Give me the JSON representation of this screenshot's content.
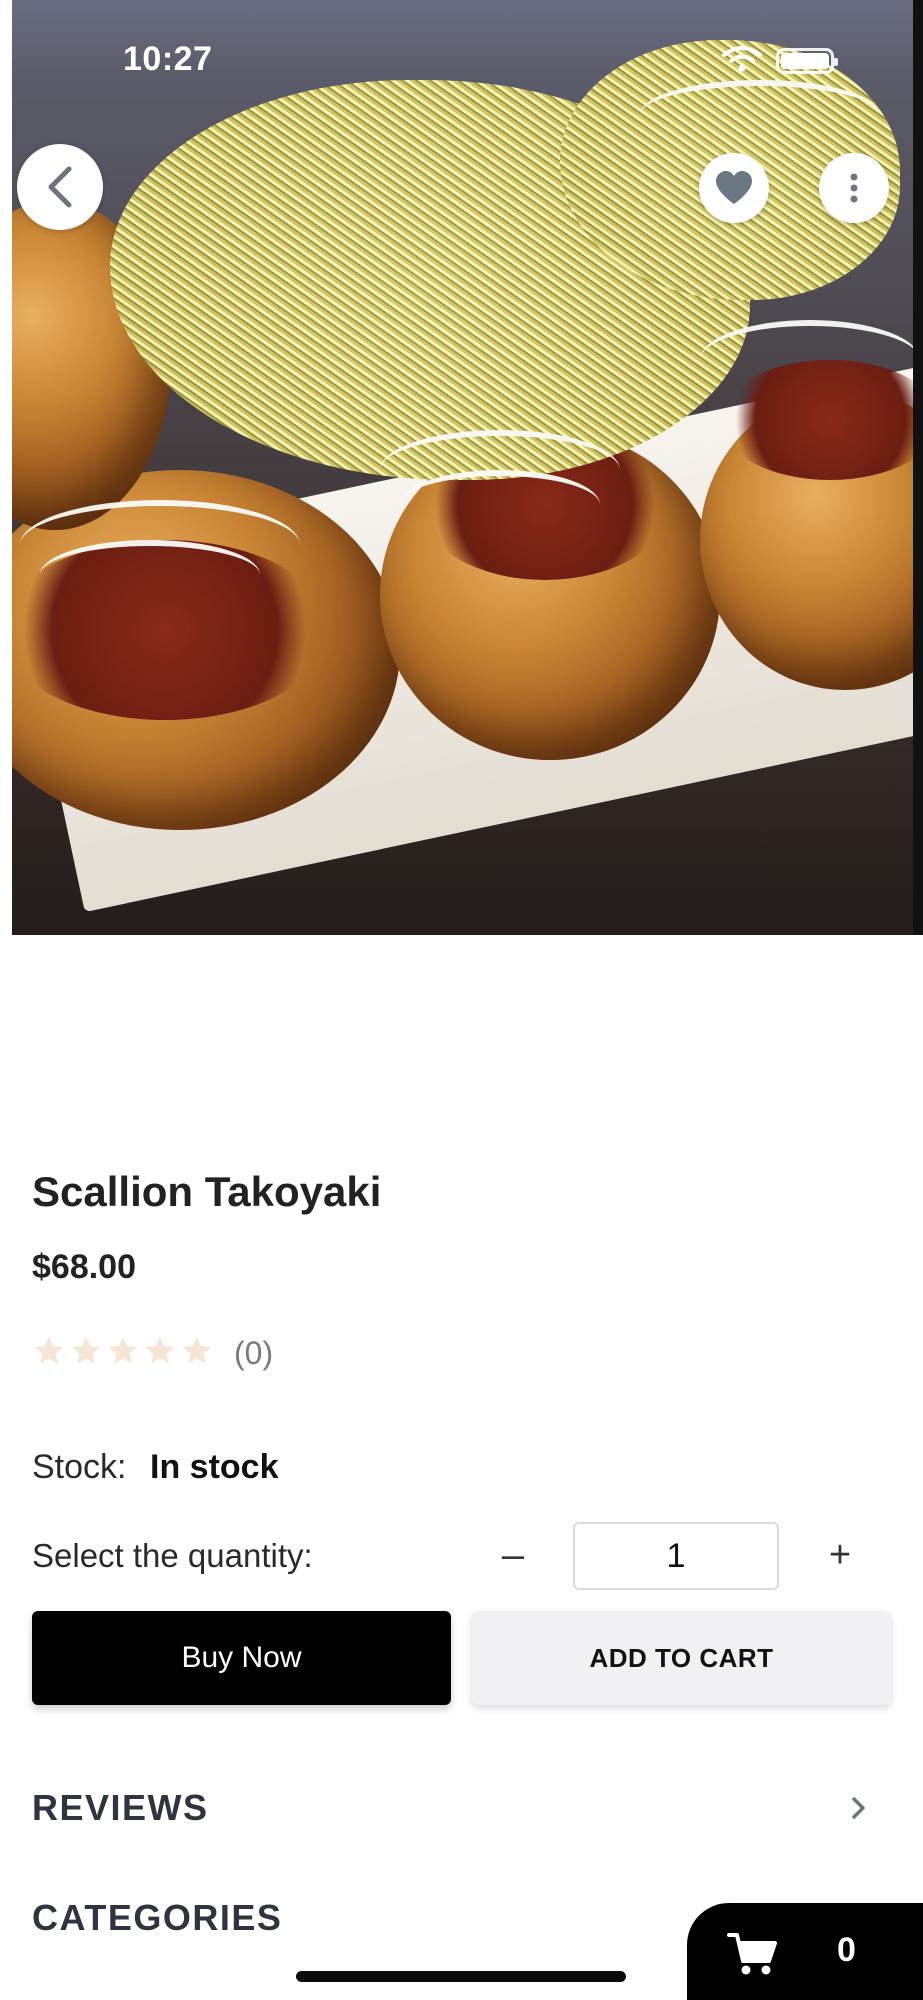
{
  "status_bar": {
    "time": "10:27"
  },
  "product": {
    "image_alt": "Scallion Takoyaki",
    "title": "Scallion Takoyaki",
    "price": "$68.00",
    "rating_stars": 0,
    "rating_count": "(0)",
    "stock_label": "Stock:",
    "stock_value": "In stock"
  },
  "quantity": {
    "label": "Select the quantity:",
    "minus": "–",
    "value": "1",
    "plus": "+"
  },
  "actions": {
    "buy_now": "Buy Now",
    "add_to_cart": "ADD TO CART"
  },
  "sections": {
    "reviews": "REVIEWS",
    "categories": "CATEGORIES"
  },
  "cart": {
    "count": "0"
  },
  "icons": {
    "back": "chevron-left-icon",
    "favorite": "heart-icon",
    "more": "more-vertical-icon",
    "cart": "cart-icon",
    "chevron": "chevron-right-icon"
  },
  "colors": {
    "primary_button": "#000000",
    "secondary_button": "#f1f1f3",
    "star_empty": "#f7e6d3",
    "section_title": "#2f3440"
  }
}
